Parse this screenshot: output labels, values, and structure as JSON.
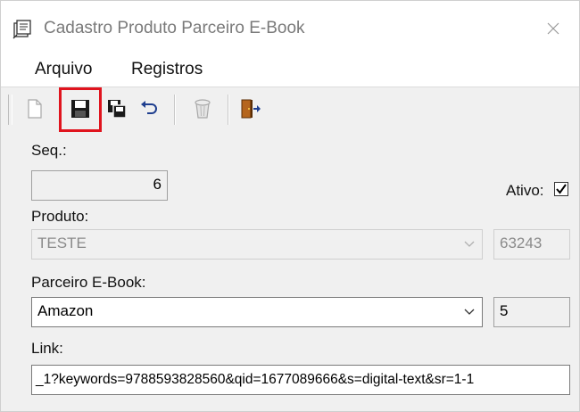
{
  "window": {
    "title": "Cadastro Produto Parceiro E-Book",
    "close_symbol": "✕"
  },
  "menu": {
    "items": [
      {
        "label": "Arquivo"
      },
      {
        "label": "Registros"
      }
    ]
  },
  "toolbar": {
    "buttons": [
      {
        "name": "new-document-icon",
        "enabled": false
      },
      {
        "name": "save-icon",
        "enabled": true,
        "highlighted": true
      },
      {
        "name": "save-copy-icon",
        "enabled": true
      },
      {
        "name": "undo-icon",
        "enabled": true
      },
      {
        "name": "delete-icon",
        "enabled": false
      },
      {
        "name": "exit-door-icon",
        "enabled": true
      }
    ],
    "highlight_color": "#e0141e"
  },
  "form": {
    "seq_label": "Seq.:",
    "seq_value": "6",
    "ativo_label": "Ativo:",
    "ativo_checked": true,
    "produto_label": "Produto:",
    "produto_value": "TESTE",
    "produto_code": "63243",
    "parceiro_label": "Parceiro E-Book:",
    "parceiro_value": "Amazon",
    "parceiro_code": "5",
    "link_label": "Link:",
    "link_value": "_1?keywords=9788593828560&qid=1677089666&s=digital-text&sr=1-1"
  }
}
